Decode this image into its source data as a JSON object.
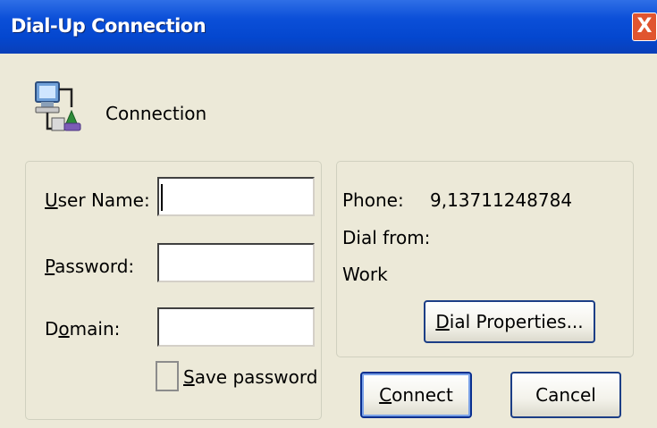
{
  "window": {
    "title": "Dial-Up Connection",
    "close_glyph": "X"
  },
  "header": {
    "icon": "network-connection-icon",
    "label": "Connection"
  },
  "credentials": {
    "username_label": {
      "pre": "",
      "key": "U",
      "post": "ser Name:"
    },
    "password_label": {
      "pre": "",
      "key": "P",
      "post": "assword:"
    },
    "domain_label": {
      "pre": "D",
      "key": "o",
      "post": "main:"
    },
    "username_value": "",
    "password_value": "",
    "domain_value": "",
    "save_password": {
      "pre": "",
      "key": "S",
      "post": "ave password",
      "checked": false
    }
  },
  "phone_info": {
    "phone_label": "Phone:",
    "phone_value": "9,13711248784",
    "dial_from_label": "Dial from:",
    "location": "Work",
    "dial_properties_button": {
      "pre": "",
      "key": "D",
      "post": "ial Properties..."
    }
  },
  "buttons": {
    "connect": {
      "pre": "",
      "key": "C",
      "post": "onnect"
    },
    "cancel": "Cancel"
  },
  "colors": {
    "title_bar": "#0447cf",
    "close_button": "#e0552f",
    "dialog_background": "#ece9d8"
  }
}
